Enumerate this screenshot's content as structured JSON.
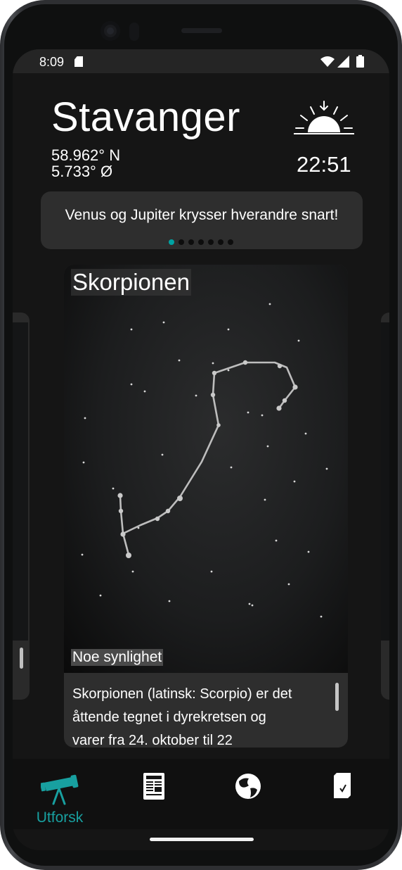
{
  "status": {
    "time": "8:09"
  },
  "location": {
    "city": "Stavanger",
    "latitude": "58.962° N",
    "longitude": "5.733° Ø"
  },
  "sun": {
    "icon": "sunset-icon",
    "time": "22:51"
  },
  "news": {
    "text": "Venus og Jupiter krysser hverandre snart!",
    "page_count": 7,
    "active_index": 0
  },
  "constellation": {
    "title": "Skorpionen",
    "visibility": "Noe synlighet",
    "description": " Skorpionen (latinsk: Scorpio) er det\nåttende tegnet i dyrekretsen og\nvarer fra 24. oktober til 22"
  },
  "nav": {
    "items": [
      {
        "label": "Utforsk",
        "icon": "telescope-icon",
        "active": true
      },
      {
        "label": "",
        "icon": "newspaper-icon",
        "active": false
      },
      {
        "label": "",
        "icon": "globe-icon",
        "active": false
      },
      {
        "label": "",
        "icon": "checklist-icon",
        "active": false
      }
    ]
  },
  "colors": {
    "accent": "#00a3a3",
    "background": "#151515",
    "card": "#2e2e2e"
  }
}
